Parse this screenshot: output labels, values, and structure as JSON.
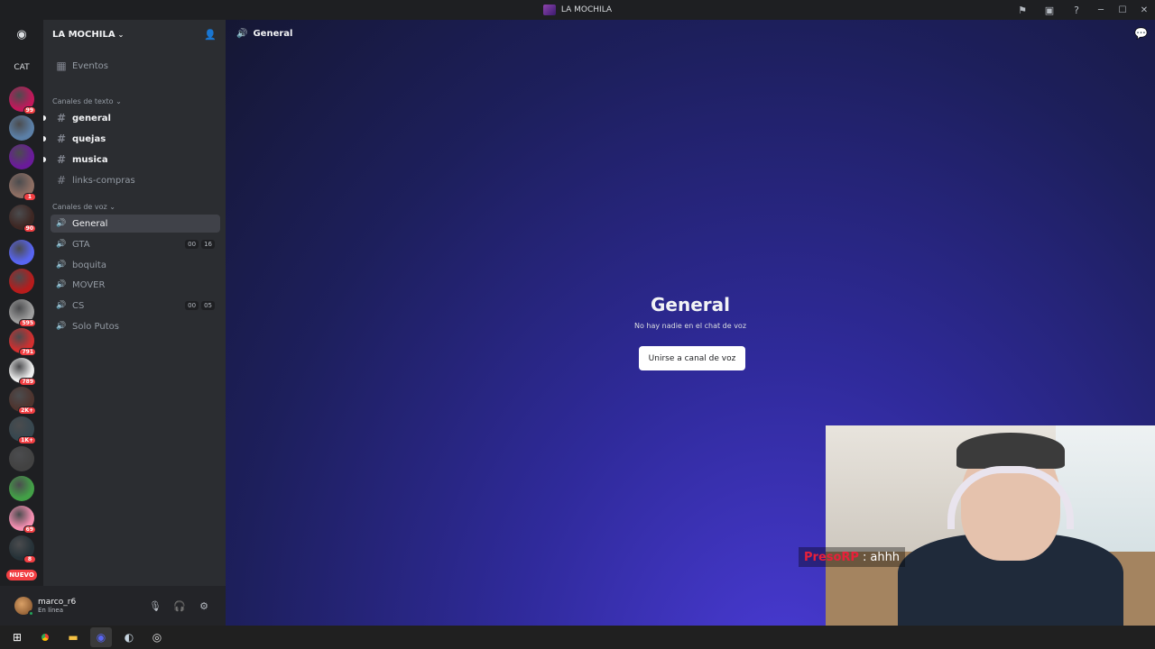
{
  "window": {
    "title": "LA MOCHILA",
    "icons": [
      "flag-icon",
      "inbox-icon",
      "help-icon"
    ],
    "controls": [
      "minimize",
      "maximize",
      "close"
    ]
  },
  "rail": {
    "home_icon": "discord-icon",
    "cat_label": "CAT",
    "servers": [
      {
        "badge": "99",
        "color": "#c2185b"
      },
      {
        "badge": "",
        "color": "#5b7fa6"
      },
      {
        "badge": "",
        "color": "#6a1b9a"
      },
      {
        "badge": "1",
        "color": "#8d6e63"
      },
      {
        "badge": "90",
        "color": "#3e2723"
      },
      {
        "badge": "",
        "color": "#5865f2"
      },
      {
        "badge": "",
        "color": "#b71c1c"
      },
      {
        "badge": "595",
        "color": "#9e9e9e"
      },
      {
        "badge": "791",
        "color": "#d32f2f"
      },
      {
        "badge": "789",
        "color": "#eeeeee"
      },
      {
        "badge": "2K+",
        "color": "#4e342e"
      },
      {
        "badge": "1K+",
        "color": "#37474f"
      },
      {
        "badge": "",
        "color": "#424242"
      },
      {
        "badge": "",
        "color": "#43a047"
      },
      {
        "badge": "69",
        "color": "#f48fb1"
      },
      {
        "badge": "8",
        "color": "#263238"
      }
    ],
    "nuevo_label": "NUEVO"
  },
  "sidebar": {
    "guild_name": "LA MOCHILA",
    "events_label": "Eventos",
    "text_category": "Canales de texto",
    "text_channels": [
      {
        "name": "general",
        "unread": true
      },
      {
        "name": "quejas",
        "unread": true
      },
      {
        "name": "musica",
        "unread": true
      },
      {
        "name": "links-compras",
        "unread": false
      }
    ],
    "voice_category": "Canales de voz",
    "voice_channels": [
      {
        "name": "General",
        "selected": true,
        "counts": []
      },
      {
        "name": "GTA",
        "selected": false,
        "counts": [
          "00",
          "16"
        ]
      },
      {
        "name": "boquita",
        "selected": false,
        "counts": []
      },
      {
        "name": "MOVER",
        "selected": false,
        "counts": []
      },
      {
        "name": "CS",
        "selected": false,
        "counts": [
          "00",
          "05"
        ]
      },
      {
        "name": "Solo Putos",
        "selected": false,
        "counts": []
      }
    ]
  },
  "user": {
    "name": "marco_r6",
    "status": "En línea"
  },
  "main": {
    "channel_name": "General",
    "heading": "General",
    "subtitle": "No hay nadie en el chat de voz",
    "join_button": "Unirse a canal de voz"
  },
  "stream_chat": {
    "user": "PresoRP",
    "separator": ":",
    "message": "ahhh"
  },
  "taskbar": {
    "apps": [
      "windows-start-icon",
      "chrome-icon",
      "file-explorer-icon",
      "discord-icon",
      "steam-icon",
      "obs-icon"
    ]
  }
}
